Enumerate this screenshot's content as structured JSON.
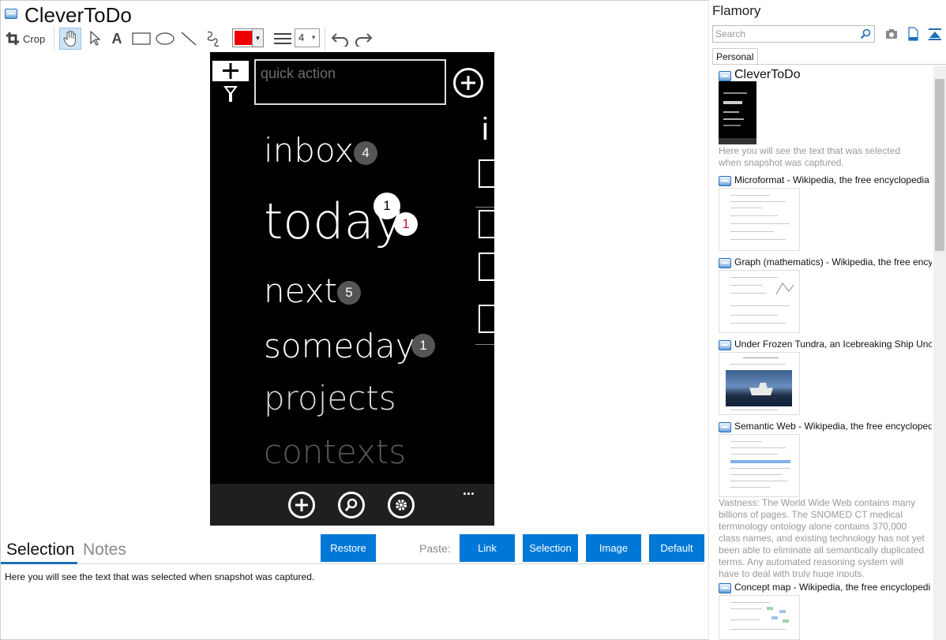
{
  "document": {
    "title": "CleverToDo"
  },
  "toolbar": {
    "crop_label": "Crop",
    "line_width": "4",
    "pen_color": "#ee0000"
  },
  "phone": {
    "quick_action_placeholder": "quick action",
    "items": [
      {
        "label": "inbox",
        "badge": "4"
      },
      {
        "label": "today",
        "badge": "1",
        "badge_overdue": "1"
      },
      {
        "label": "next",
        "badge": "5"
      },
      {
        "label": "someday",
        "badge": "1"
      },
      {
        "label": "projects"
      },
      {
        "label": "contexts"
      }
    ],
    "side_letter": "i",
    "more_label": "..."
  },
  "notes": {
    "tabs": [
      "Selection",
      "Notes"
    ],
    "restore_label": "Restore",
    "paste_label": "Paste:",
    "paste_buttons": [
      "Link",
      "Selection",
      "Image",
      "Default"
    ],
    "selection_text": "Here you will see the text that was selected when snapshot was captured."
  },
  "sidebar": {
    "brand": "Flamory",
    "search_placeholder": "Search",
    "tab_label": "Personal",
    "snapshots": [
      {
        "title": "CleverToDo",
        "description": "Here you will see the text that was selected when snapshot was captured."
      },
      {
        "title": "Microformat - Wikipedia, the free encyclopedia"
      },
      {
        "title": "Graph (mathematics) - Wikipedia, the free ency"
      },
      {
        "title": "Under Frozen Tundra, an Icebreaking Ship Unco"
      },
      {
        "title": "Semantic Web - Wikipedia, the free encycloped",
        "description": "Vastness: The World Wide Web contains many billions of pages. The SNOMED CT medical terminology ontology alone contains 370,000 class names, and existing technology has not yet been able to eliminate all semantically duplicated terms. Any automated reasoning system will have to deal with truly huge inputs."
      },
      {
        "title": "Concept map - Wikipedia, the free encyclopedi"
      }
    ]
  },
  "colors": {
    "accent": "#0078d7",
    "phone_bg": "#000000",
    "muted": "#999999"
  }
}
